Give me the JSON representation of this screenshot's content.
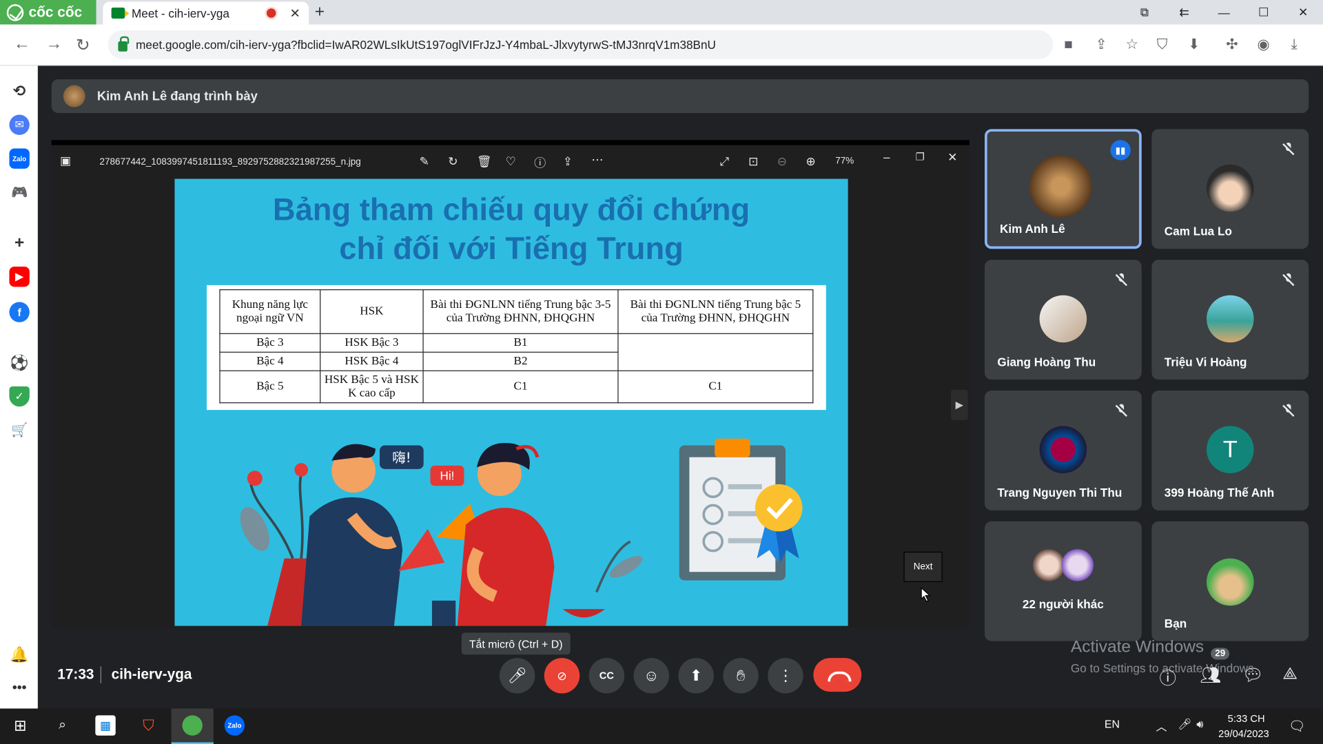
{
  "browser": {
    "brand": "cốc cốc",
    "tab_title": "Meet - cih-ierv-yga",
    "url": "meet.google.com/cih-ierv-yga?fbclid=IwAR02WLsIkUtS197oglVIFrJzJ-Y4mbaL-JlxvytyrwS-tMJ3nrqV1m38BnU"
  },
  "presenter": {
    "text": "Kim Anh Lê đang trình bày"
  },
  "viewer": {
    "filename": "278677442_1083997451811193_8929752882321987255_n.jpg",
    "zoom": "77%",
    "next_tooltip": "Next"
  },
  "slide": {
    "title_line1": "Bảng tham chiếu quy đổi chứng",
    "title_line2": "chỉ đối với Tiếng Trung",
    "headers": [
      "Khung năng lực ngoại ngữ VN",
      "HSK",
      "Bài thi ĐGNLNN tiếng Trung bậc 3-5 của Trường ĐHNN, ĐHQGHN",
      "Bài thi ĐGNLNN tiếng Trung bậc 5 của Trường ĐHNN, ĐHQGHN"
    ],
    "rows": [
      [
        "Bậc 3",
        "HSK Bậc 3",
        "B1",
        ""
      ],
      [
        "Bậc 4",
        "HSK Bậc 4",
        "B2",
        ""
      ],
      [
        "Bậc 5",
        "HSK Bậc 5 và HSK K cao cấp",
        "C1",
        "C1"
      ]
    ],
    "bubble1": "嗨!",
    "bubble2": "Hi!"
  },
  "participants": [
    {
      "name": "Kim Anh Lê"
    },
    {
      "name": "Cam Lua Lo"
    },
    {
      "name": "Giang Hoàng Thu"
    },
    {
      "name": "Triệu Vi Hoàng"
    },
    {
      "name": "Trang Nguyen Thi Thu"
    },
    {
      "name": "399 Hoàng Thế Anh",
      "initial": "T"
    },
    {
      "name": "22 người khác"
    },
    {
      "name": "Bạn"
    }
  ],
  "bottom": {
    "time": "17:33",
    "meeting_code": "cih-ierv-yga",
    "mic_tooltip": "Tắt micrô (Ctrl + D)",
    "people_count": "29"
  },
  "watermark": {
    "line1": "Activate Windows",
    "line2": "Go to Settings to activate Windows."
  },
  "taskbar": {
    "lang": "EN",
    "clock": "5:33 CH",
    "date": "29/04/2023"
  },
  "colors": {
    "meet_bg": "#202124",
    "tile_bg": "#3c4043",
    "end_call": "#ea4335",
    "active_border": "#8ab4f8",
    "slide_bg": "#2ebde0",
    "slide_title": "#1a6fb0"
  }
}
